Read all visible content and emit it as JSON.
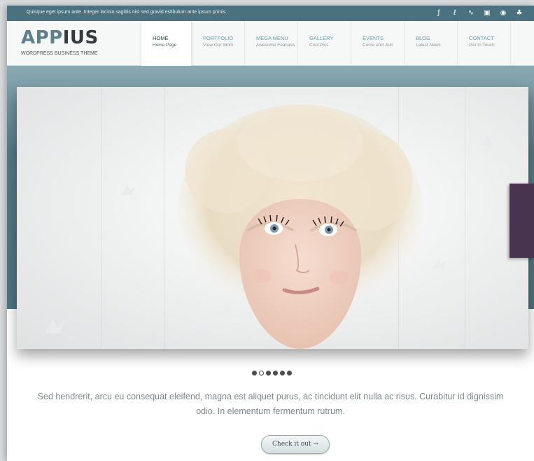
{
  "topbar": {
    "text": "Quisque eget ipsum ante. Integer lacinia sagittis nisl sed gravid estibulum ante ipsum primis",
    "social_icons": [
      {
        "name": "facebook-icon",
        "glyph": "ƒ"
      },
      {
        "name": "linkedin-icon",
        "glyph": "in"
      },
      {
        "name": "rss-icon",
        "glyph": "&#8718;"
      },
      {
        "name": "square-icon",
        "glyph": "▣"
      },
      {
        "name": "dribbble-icon",
        "glyph": "◉"
      },
      {
        "name": "tree-icon",
        "glyph": "♣"
      }
    ]
  },
  "header": {
    "logo_part1": "APP",
    "logo_part2": "IUS",
    "tagline": "WORDPRESS BUSINESS THEME"
  },
  "nav": [
    {
      "title": "HOME",
      "subtitle": "Home Page",
      "active": true
    },
    {
      "title": "PORTFOLIO",
      "subtitle": "View Our Work",
      "active": false
    },
    {
      "title": "MEGA MENU",
      "subtitle": "Awesome Features",
      "active": false
    },
    {
      "title": "GALLERY",
      "subtitle": "Cool Pics",
      "active": false
    },
    {
      "title": "EVENTS",
      "subtitle": "Come and Join",
      "active": false
    },
    {
      "title": "BLOG",
      "subtitle": "Latest News",
      "active": false
    },
    {
      "title": "CONTACT",
      "subtitle": "Get In Touch",
      "active": false
    }
  ],
  "slider": {
    "active_index": 1,
    "slide_count": 6
  },
  "lead": "Sed hendrerit, arcu eu consequat eleifend, magna est aliquet purus, ac tincidunt elit nulla ac risus. Curabitur id dignissim odio. In elementum fermentum rutrum.",
  "cta_label": "Check it out →",
  "colors": {
    "topbar": "#4a7180",
    "logo_accent": "#5d808c",
    "logo_dark": "#333b3e",
    "side_tab": "#48344f"
  }
}
